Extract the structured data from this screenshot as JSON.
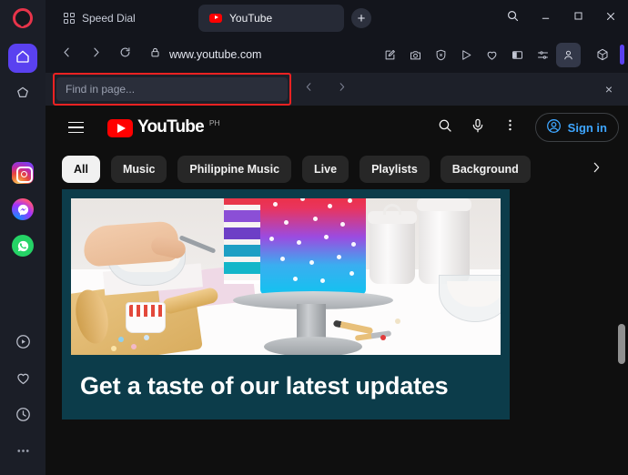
{
  "browser": {
    "name": "Opera",
    "sidebar": {
      "logo_name": "opera-logo",
      "top_items": [
        {
          "name": "home-button",
          "icon": "home-icon",
          "active": true
        },
        {
          "name": "favorites-button",
          "icon": "star-pentagon-icon",
          "active": false
        }
      ],
      "messenger_items": [
        {
          "name": "instagram-button",
          "icon": "instagram-icon"
        },
        {
          "name": "messenger-button",
          "icon": "messenger-icon"
        },
        {
          "name": "whatsapp-button",
          "icon": "whatsapp-icon"
        }
      ],
      "bottom_items": [
        {
          "name": "player-button",
          "icon": "play-circle-icon"
        },
        {
          "name": "favorites-heart-button",
          "icon": "heart-icon"
        },
        {
          "name": "history-button",
          "icon": "clock-icon"
        },
        {
          "name": "more-button",
          "icon": "ellipsis-icon"
        }
      ]
    },
    "tabs": [
      {
        "title": "Speed Dial",
        "icon": "speed-dial-icon",
        "active": false
      },
      {
        "title": "YouTube",
        "icon": "youtube-favicon",
        "active": true
      }
    ],
    "new_tab_label": "+",
    "window_controls": {
      "search": "search-icon",
      "minimize": "minimize-icon",
      "maximize": "maximize-icon",
      "close": "close-icon"
    },
    "navigation": {
      "back": "back-arrow-icon",
      "forward": "forward-arrow-icon",
      "reload": "reload-icon",
      "lock": "padlock-icon",
      "url": "www.youtube.com"
    },
    "address_actions": [
      {
        "name": "edit-note-icon"
      },
      {
        "name": "snapshot-camera-icon"
      },
      {
        "name": "ad-blocker-shield-icon"
      },
      {
        "name": "vpn-send-icon"
      },
      {
        "name": "heart-icon"
      },
      {
        "name": "sidebar-panel-icon"
      },
      {
        "name": "easy-setup-sliders-icon"
      },
      {
        "name": "profile-person-icon"
      }
    ],
    "extensions": [
      {
        "name": "cube-extension-icon"
      }
    ],
    "find_bar": {
      "placeholder": "Find in page...",
      "value": "",
      "prev_label": "previous-match",
      "next_label": "next-match",
      "close_label": "×",
      "highlight_color": "#ee2222"
    }
  },
  "page": {
    "site": "YouTube",
    "header": {
      "menu": "hamburger-menu-icon",
      "logo_text": "YouTube",
      "country_code": "PH",
      "search": "search-icon",
      "voice": "microphone-icon",
      "more": "vertical-dots-icon",
      "sign_in_label": "Sign in"
    },
    "chips": [
      {
        "label": "All",
        "selected": true
      },
      {
        "label": "Music",
        "selected": false
      },
      {
        "label": "Philippine Music",
        "selected": false
      },
      {
        "label": "Live",
        "selected": false
      },
      {
        "label": "Playlists",
        "selected": false
      },
      {
        "label": "Background",
        "selected": false
      }
    ],
    "chips_next": "chevron-right-icon",
    "banner": {
      "title": "Get a taste of our latest updates",
      "background_color": "#0c3c4a",
      "image_alt": "cake-decorating-photo"
    },
    "scrollbar": {
      "name": "page-scrollbar"
    }
  }
}
